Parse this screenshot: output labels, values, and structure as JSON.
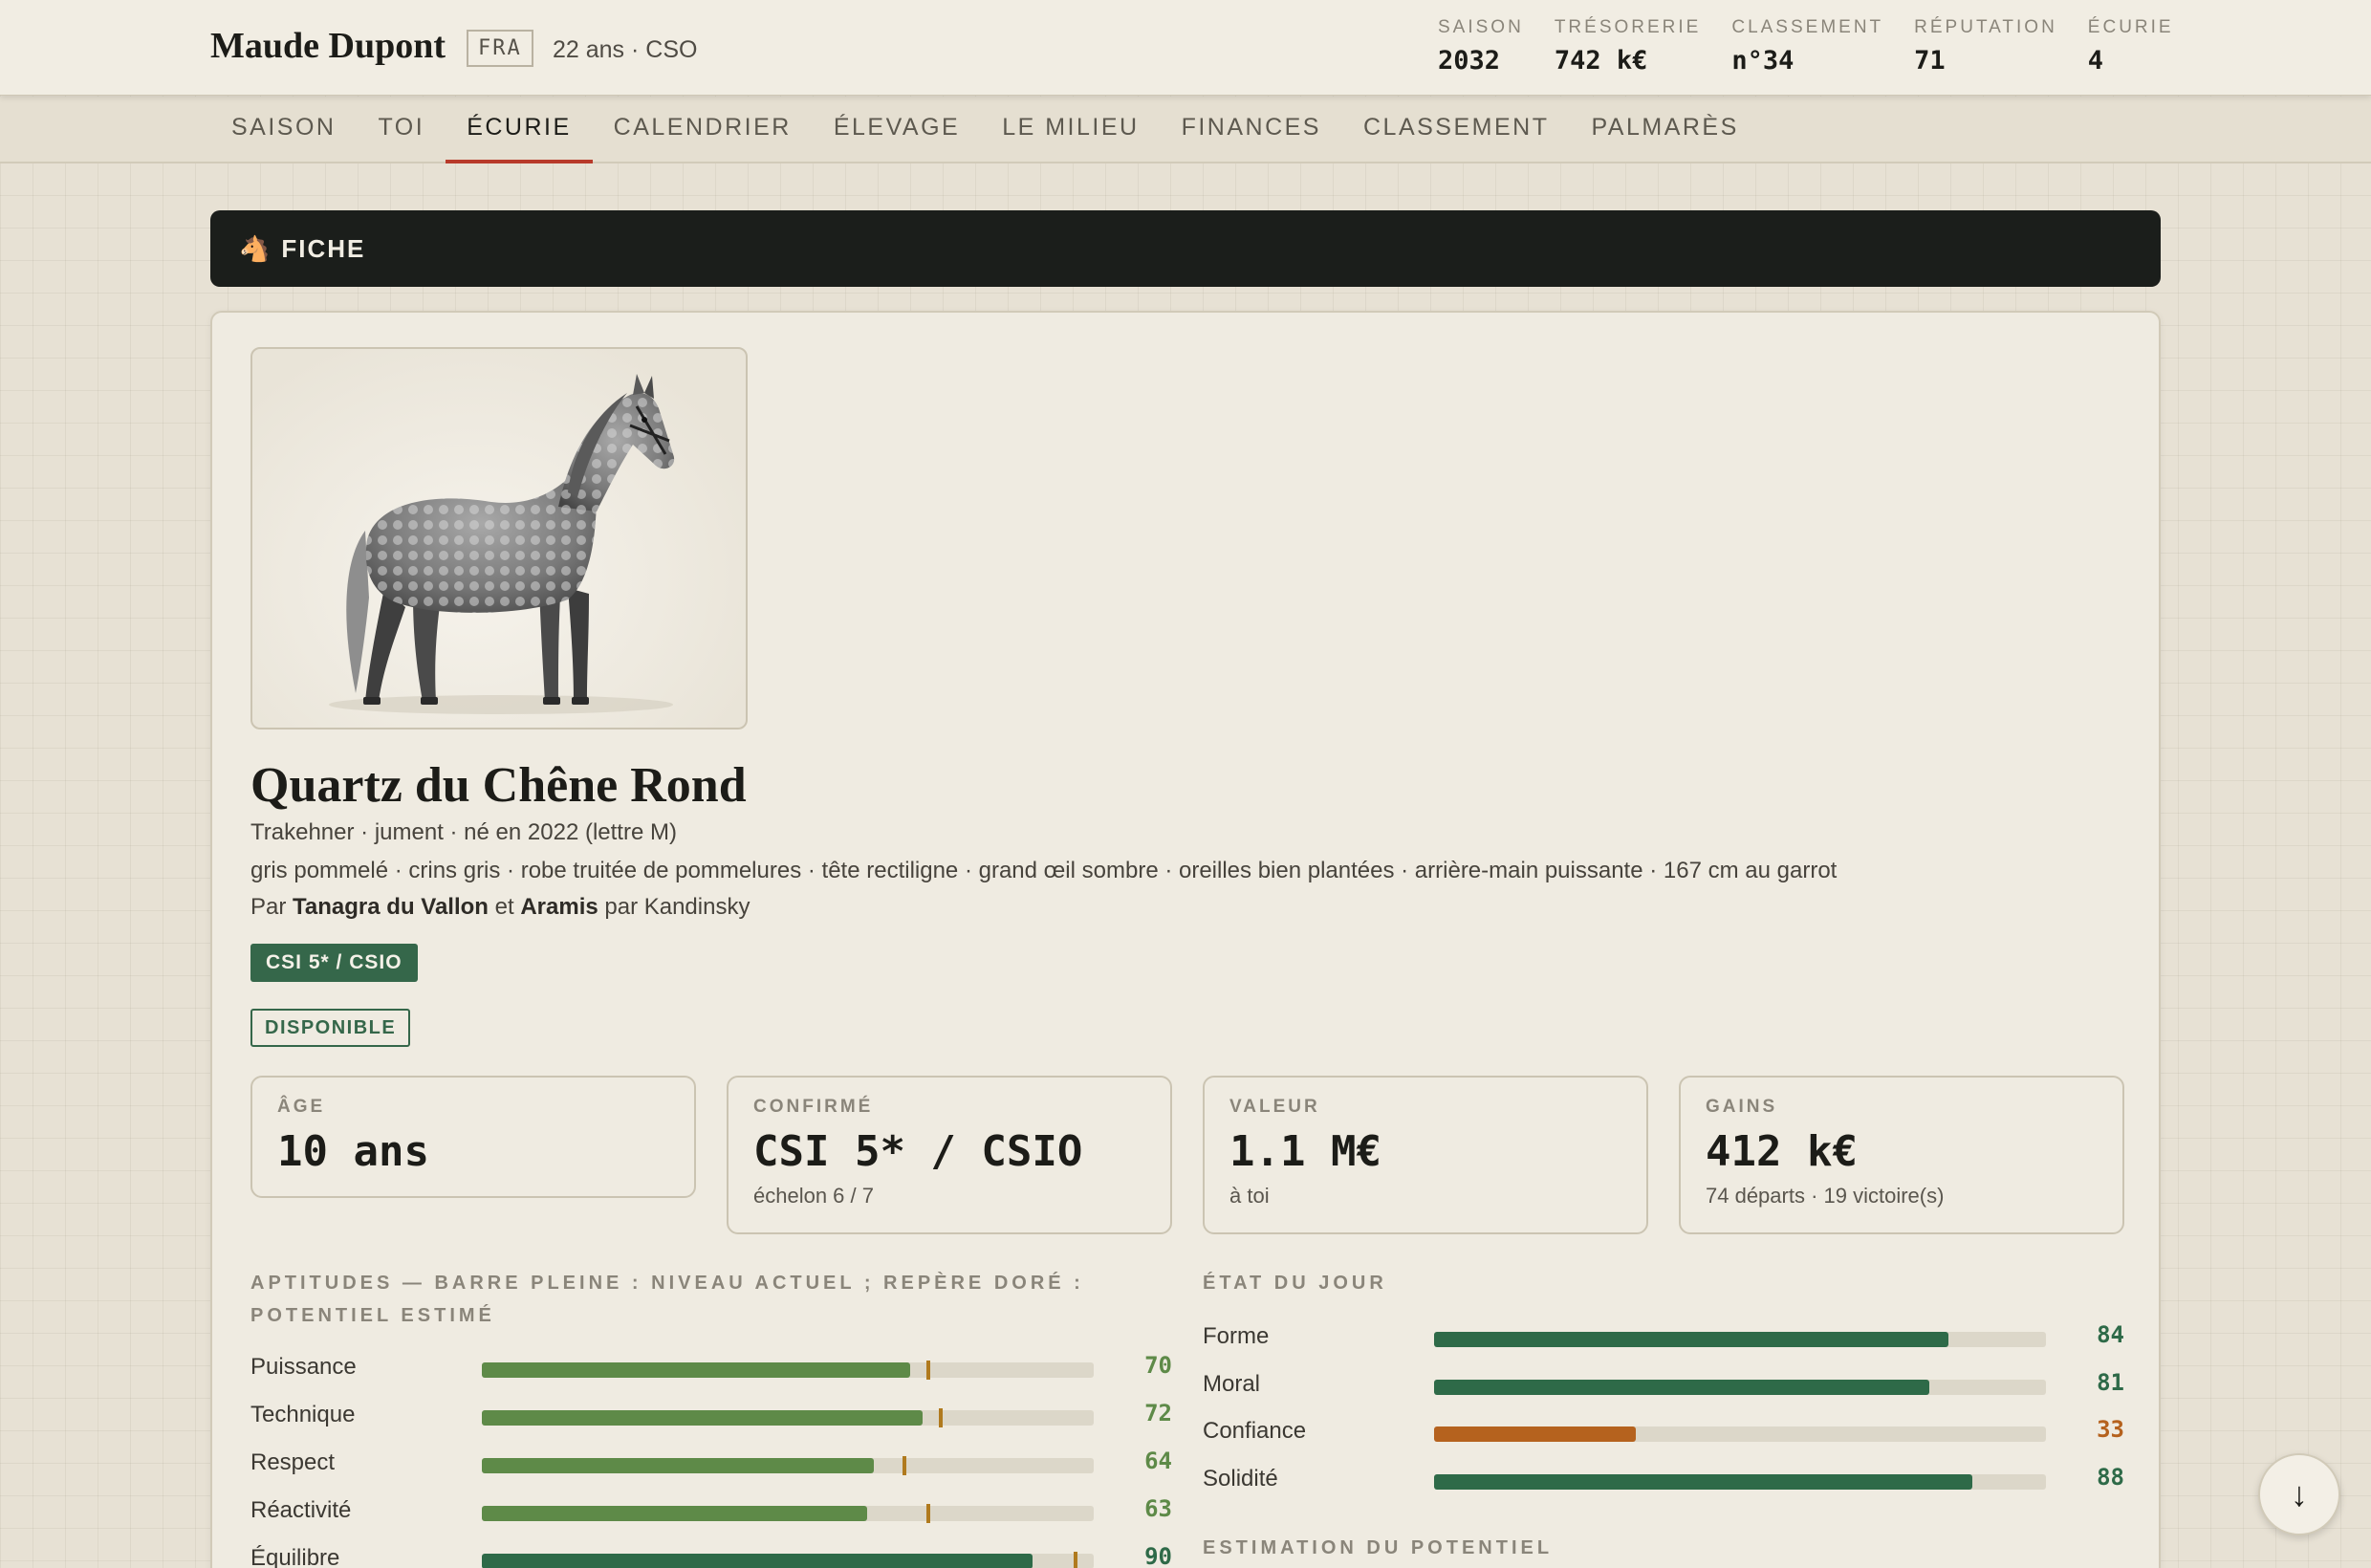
{
  "player": {
    "name": "Maude Dupont",
    "nation": "FRA",
    "meta": "22 ans · CSO"
  },
  "stats": [
    {
      "label": "SAISON",
      "value": "2032"
    },
    {
      "label": "TRÉSORERIE",
      "value": "742 k€"
    },
    {
      "label": "CLASSEMENT",
      "value": "n°34"
    },
    {
      "label": "RÉPUTATION",
      "value": "71"
    },
    {
      "label": "ÉCURIE",
      "value": "4"
    }
  ],
  "nav": {
    "tabs": [
      "SAISON",
      "TOI",
      "ÉCURIE",
      "CALENDRIER",
      "ÉLEVAGE",
      "LE MILIEU",
      "FINANCES",
      "CLASSEMENT",
      "PALMARÈS"
    ],
    "active": "ÉCURIE"
  },
  "section": {
    "icon": "horse-head-icon",
    "icon_glyph": "🐴",
    "title": "FICHE"
  },
  "horse": {
    "name": "Quartz du Chêne Rond",
    "subtitle": "Trakehner · jument · né en 2022 (lettre M)",
    "description": "gris pommelé · crins gris · robe truitée de pommelures · tête rectiligne · grand œil sombre · oreilles bien plantées · arrière-main puissante · 167 cm au garrot",
    "pedigree": {
      "prefix": "Par",
      "sire": "Tanagra du Vallon",
      "conj": "et",
      "dam": "Aramis",
      "suffix": "par Kandinsky"
    },
    "level_badge": "CSI 5* / CSIO",
    "status_badge": "DISPONIBLE"
  },
  "info_boxes": [
    {
      "label": "ÂGE",
      "value": "10 ans",
      "sub": ""
    },
    {
      "label": "CONFIRMÉ",
      "value": "CSI 5* / CSIO",
      "sub": "échelon 6 / 7"
    },
    {
      "label": "VALEUR",
      "value": "1.1 M€",
      "sub": "à toi"
    },
    {
      "label": "GAINS",
      "value": "412 k€",
      "sub": "74 départs · 19 victoire(s)"
    }
  ],
  "aptitudes": {
    "title": "APTITUDES — BARRE PLEINE : NIVEAU ACTUEL ; REPÈRE DORÉ : POTENTIEL ESTIMÉ",
    "items": [
      {
        "label": "Puissance",
        "value": 70,
        "potential": 73,
        "color": "#5e8a48",
        "text_color": "#5e8a48"
      },
      {
        "label": "Technique",
        "value": 72,
        "potential": 75,
        "color": "#5e8a48",
        "text_color": "#5e8a48"
      },
      {
        "label": "Respect",
        "value": 64,
        "potential": 69,
        "color": "#5e8a48",
        "text_color": "#5e8a48"
      },
      {
        "label": "Réactivité",
        "value": 63,
        "potential": 73,
        "color": "#5e8a48",
        "text_color": "#5e8a48"
      },
      {
        "label": "Équilibre",
        "value": 90,
        "potential": 97,
        "color": "#2e6a48",
        "text_color": "#2e6a48"
      }
    ]
  },
  "etat": {
    "title": "ÉTAT DU JOUR",
    "items": [
      {
        "label": "Forme",
        "value": 84,
        "color": "#2e6a48",
        "text_color": "#2e6a48"
      },
      {
        "label": "Moral",
        "value": 81,
        "color": "#2e6a48",
        "text_color": "#2e6a48"
      },
      {
        "label": "Confiance",
        "value": 33,
        "color": "#b5621e",
        "text_color": "#b5621e"
      },
      {
        "label": "Solidité",
        "value": 88,
        "color": "#2e6a48",
        "text_color": "#2e6a48"
      }
    ]
  },
  "potential_title": "ESTIMATION DU POTENTIEL",
  "scroll_button": {
    "icon": "arrow-down-icon",
    "glyph": "↓"
  }
}
